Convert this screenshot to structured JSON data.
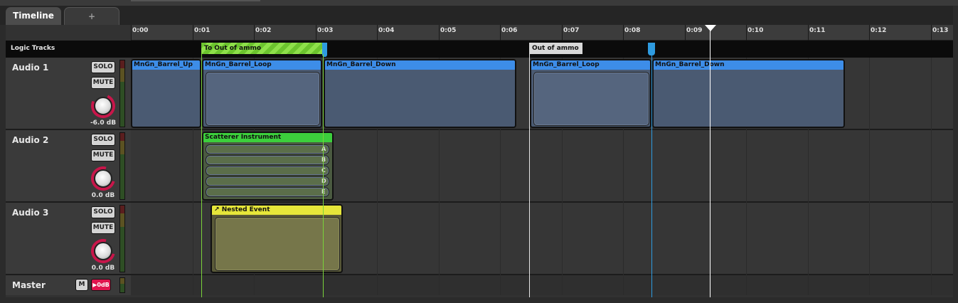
{
  "tabs": {
    "timeline": "Timeline",
    "add": "+"
  },
  "ruler": {
    "ticks": [
      "0:00",
      "0:01",
      "0:02",
      "0:03",
      "0:04",
      "0:05",
      "0:06",
      "0:07",
      "0:08",
      "0:09",
      "0:10",
      "0:11",
      "0:12",
      "0:13"
    ]
  },
  "logic": {
    "label": "Logic Tracks",
    "transition_prefix": "To",
    "transition_label": "Out of ammo",
    "marker_label": "Out of ammo"
  },
  "tracks": {
    "audio1": {
      "name": "Audio 1",
      "solo": "SOLO",
      "mute": "MUTE",
      "volume": "-6.0 dB",
      "clips": [
        "MnGn_Barrel_Up",
        "MnGn_Barrel_Loop",
        "MnGn_Barrel_Down",
        "MnGn_Barrel_Loop",
        "MnGn_Barrel_Down"
      ]
    },
    "audio2": {
      "name": "Audio 2",
      "solo": "SOLO",
      "mute": "MUTE",
      "volume": "0.0 dB",
      "instrument": {
        "label": "Scatterer Instrument",
        "slots": [
          "A",
          "B",
          "C",
          "D",
          "E"
        ]
      }
    },
    "audio3": {
      "name": "Audio 3",
      "solo": "SOLO",
      "mute": "MUTE",
      "volume": "0.0 dB",
      "nested": {
        "label": "Nested Event",
        "icon": "arrow-icon"
      }
    },
    "master": {
      "name": "Master",
      "mute": "M",
      "level": "0dB"
    }
  },
  "colors": {
    "audio_clip": "#3d8de8",
    "scatterer": "#3ccf3c",
    "nested": "#e6e63a",
    "transition": "#7ad33a",
    "knob_ring": "#c8164a",
    "master_level": "#e0144e"
  }
}
